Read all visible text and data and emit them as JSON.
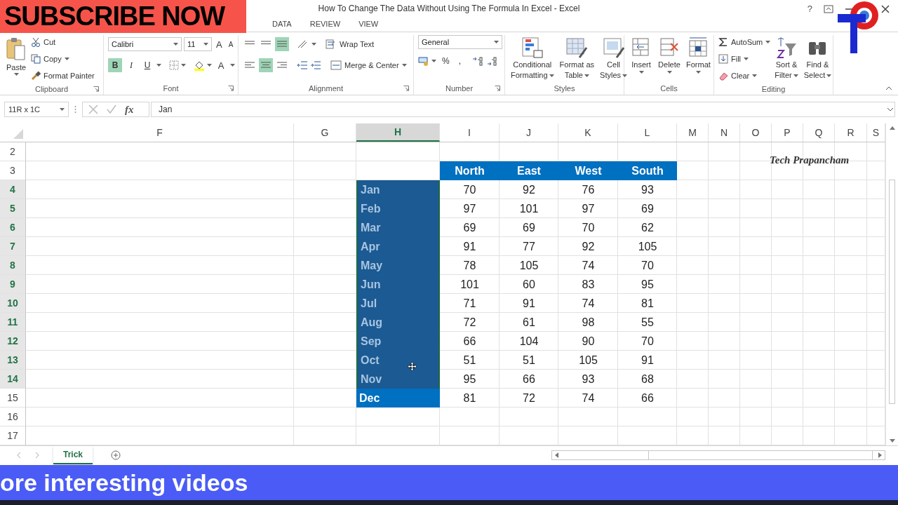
{
  "overlays": {
    "top_banner": "SUBSCRIBE NOW",
    "bottom_banner": "ore interesting videos",
    "sheet_caption": "Tech Prapancham"
  },
  "window": {
    "title": "How To Change The Data Without Using The Formula In Excel - Excel",
    "help": "?"
  },
  "ribbon_tabs": [
    {
      "label": "DATA",
      "selected": false
    },
    {
      "label": "REVIEW",
      "selected": false
    },
    {
      "label": "VIEW",
      "selected": false
    }
  ],
  "clipboard": {
    "paste": "Paste",
    "cut": "Cut",
    "copy": "Copy",
    "format_painter": "Format Painter",
    "label": "Clipboard"
  },
  "font": {
    "name": "Calibri",
    "size": "11",
    "grow": "A",
    "shrink": "A",
    "bold": "B",
    "bold_on": true,
    "italic": "I",
    "underline": "U",
    "color_button": "A",
    "label": "Font"
  },
  "alignment": {
    "bottom_align_on": true,
    "center_on": true,
    "wrap_text": "Wrap Text",
    "merge_center": "Merge & Center",
    "label": "Alignment"
  },
  "number": {
    "format": "General",
    "percent": "%",
    "comma": ",",
    "label": "Number"
  },
  "styles": {
    "buttons": [
      {
        "line1": "Conditional",
        "line2": "Formatting",
        "kind": "conditional"
      },
      {
        "line1": "Format as",
        "line2": "Table",
        "kind": "table"
      },
      {
        "line1": "Cell",
        "line2": "Styles",
        "kind": "cellstyles"
      }
    ],
    "label": "Styles"
  },
  "cells": {
    "buttons": [
      {
        "label": "Insert",
        "kind": "insert"
      },
      {
        "label": "Delete",
        "kind": "delete"
      },
      {
        "label": "Format",
        "kind": "format"
      }
    ],
    "label": "Cells"
  },
  "editing": {
    "autosum": "AutoSum",
    "fill": "Fill",
    "clear": "Clear",
    "sort": {
      "line1": "Sort &",
      "line2": "Filter"
    },
    "find": {
      "line1": "Find &",
      "line2": "Select"
    },
    "label": "Editing"
  },
  "formula_bar": {
    "name_box": "11R x 1C",
    "fx": "fx",
    "value": "Jan"
  },
  "sheet": {
    "columns": [
      {
        "label": "F",
        "selected": false
      },
      {
        "label": "G",
        "selected": false
      },
      {
        "label": "H",
        "selected": true
      },
      {
        "label": "I",
        "selected": false
      },
      {
        "label": "J",
        "selected": false
      },
      {
        "label": "K",
        "selected": false
      },
      {
        "label": "L",
        "selected": false
      },
      {
        "label": "M",
        "selected": false
      },
      {
        "label": "N",
        "selected": false
      },
      {
        "label": "O",
        "selected": false
      },
      {
        "label": "P",
        "selected": false
      },
      {
        "label": "Q",
        "selected": false
      },
      {
        "label": "R",
        "selected": false
      },
      {
        "label": "S",
        "selected": false
      }
    ],
    "rows": [
      {
        "number": "2",
        "kind": "empty",
        "selected": false
      },
      {
        "number": "3",
        "kind": "header",
        "selected": false,
        "labels": [
          "North",
          "East",
          "West",
          "South"
        ]
      },
      {
        "number": "4",
        "kind": "data",
        "selected": true,
        "month": "Jan",
        "values": [
          "70",
          "92",
          "76",
          "93"
        ]
      },
      {
        "number": "5",
        "kind": "data",
        "selected": true,
        "month": "Feb",
        "values": [
          "97",
          "101",
          "97",
          "69"
        ]
      },
      {
        "number": "6",
        "kind": "data",
        "selected": true,
        "month": "Mar",
        "values": [
          "69",
          "69",
          "70",
          "62"
        ]
      },
      {
        "number": "7",
        "kind": "data",
        "selected": true,
        "month": "Apr",
        "values": [
          "91",
          "77",
          "92",
          "105"
        ]
      },
      {
        "number": "8",
        "kind": "data",
        "selected": true,
        "month": "May",
        "values": [
          "78",
          "105",
          "74",
          "70"
        ]
      },
      {
        "number": "9",
        "kind": "data",
        "selected": true,
        "month": "Jun",
        "values": [
          "101",
          "60",
          "83",
          "95"
        ]
      },
      {
        "number": "10",
        "kind": "data",
        "selected": true,
        "month": "Jul",
        "values": [
          "71",
          "91",
          "74",
          "81"
        ]
      },
      {
        "number": "11",
        "kind": "data",
        "selected": true,
        "month": "Aug",
        "values": [
          "72",
          "61",
          "98",
          "55"
        ]
      },
      {
        "number": "12",
        "kind": "data",
        "selected": true,
        "month": "Sep",
        "values": [
          "66",
          "104",
          "90",
          "70"
        ]
      },
      {
        "number": "13",
        "kind": "data",
        "selected": true,
        "month": "Oct",
        "values": [
          "51",
          "51",
          "105",
          "91"
        ]
      },
      {
        "number": "14",
        "kind": "data",
        "selected": true,
        "month": "Nov",
        "values": [
          "95",
          "66",
          "93",
          "68"
        ]
      },
      {
        "number": "15",
        "kind": "data",
        "selected": false,
        "month": "Dec",
        "values": [
          "81",
          "72",
          "74",
          "66"
        ]
      },
      {
        "number": "16",
        "kind": "empty",
        "selected": false
      },
      {
        "number": "17",
        "kind": "empty",
        "selected": false
      }
    ]
  },
  "sheet_tabs": [
    {
      "label": "Trick",
      "selected": true
    }
  ]
}
